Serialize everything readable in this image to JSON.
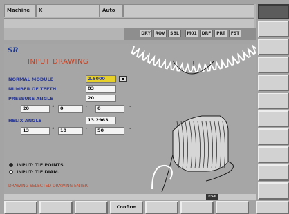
{
  "header": {
    "machine_label": "Machine",
    "machine_value": "X",
    "mode": "Auto",
    "flags": [
      "DRY",
      "ROV",
      "SBL",
      "M01",
      "DRF",
      "PRT",
      "FST"
    ]
  },
  "panel": {
    "title": "INPUT DRAWING",
    "fields": {
      "normal_module_label": "NORMAL MODULE",
      "normal_module_value": "2.5000",
      "teeth_label": "NUMBER OF TEETH",
      "teeth_value": "83",
      "pressure_label": "PRESSURE ANGLE",
      "pressure_value": "20",
      "pressure_deg": "20",
      "pressure_min": "0",
      "pressure_sec": "0",
      "helix_label": "HELIX ANGLE",
      "helix_value": "13.2963",
      "helix_deg": "13",
      "helix_min": "18",
      "helix_sec": "50"
    },
    "options": [
      {
        "label": "INPUT:  TIF POINTS",
        "selected": true
      },
      {
        "label": "INPUT:  TIF DIAM.",
        "selected": false
      }
    ],
    "status": "DRAWING SELECTED DRAWING ENTER"
  },
  "bottom": {
    "badge": "EST",
    "softkeys": [
      "",
      "",
      "",
      "Confirm",
      "",
      "",
      "",
      ""
    ]
  },
  "colors": {
    "accent": "#c84020",
    "label": "#2a3a9a",
    "selected_field": "#e8d02a"
  }
}
